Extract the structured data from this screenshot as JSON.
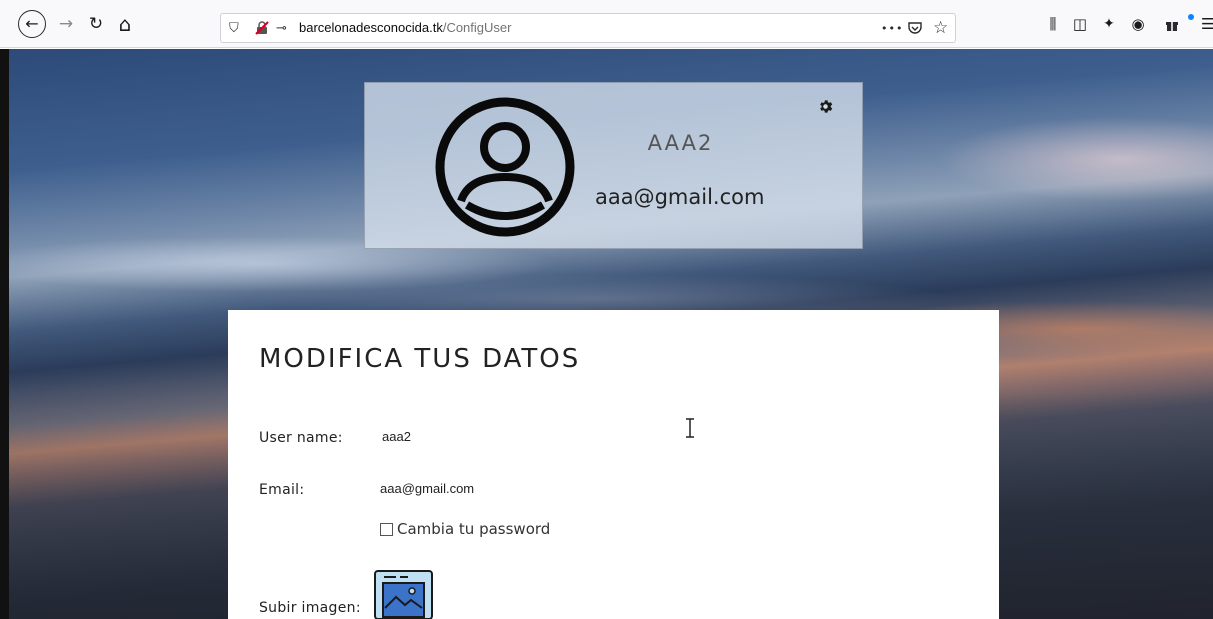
{
  "browser": {
    "url_domain": "barcelonadesconocida.tk",
    "url_path": "/ConfigUser",
    "icons": {
      "back": "back-arrow-icon",
      "forward": "forward-arrow-icon",
      "reload": "reload-icon",
      "home": "home-icon",
      "shield": "shield-icon",
      "insecure": "insecure-lock-icon",
      "key": "key-icon",
      "more": "more-dots-icon",
      "pocket": "pocket-icon",
      "bookmark": "bookmark-star-icon",
      "library": "library-icon",
      "sidebar": "sidebar-icon",
      "extension": "extension-icon",
      "account": "account-icon",
      "whats_new": "gift-icon",
      "menu": "hamburger-menu-icon"
    },
    "glyphs": {
      "back": "←",
      "forward": "→",
      "reload": "↻",
      "home": "⌂",
      "shield": "⛉",
      "key": "⊸",
      "more": "•••",
      "pocket": "⛉",
      "bookmark": "☆",
      "library": "⫼",
      "sidebar": "◫",
      "extension": "✦",
      "account": "◉",
      "whats_new": "⬚",
      "menu": "☰"
    }
  },
  "profile": {
    "name": "AAA2",
    "email": "aaa@gmail.com"
  },
  "form": {
    "title": "MODIFICA TUS DATOS",
    "username_label": "User name:",
    "username_value": "aaa2",
    "email_label": "Email:",
    "email_value": "aaa@gmail.com",
    "password_checkbox_label": "Cambia tu password",
    "upload_label": "Subir imagen:"
  },
  "colors": {
    "form_bg": "#ffffff",
    "upload_icon_blue": "#3a73c8",
    "upload_icon_frame": "#bfe0f2"
  }
}
